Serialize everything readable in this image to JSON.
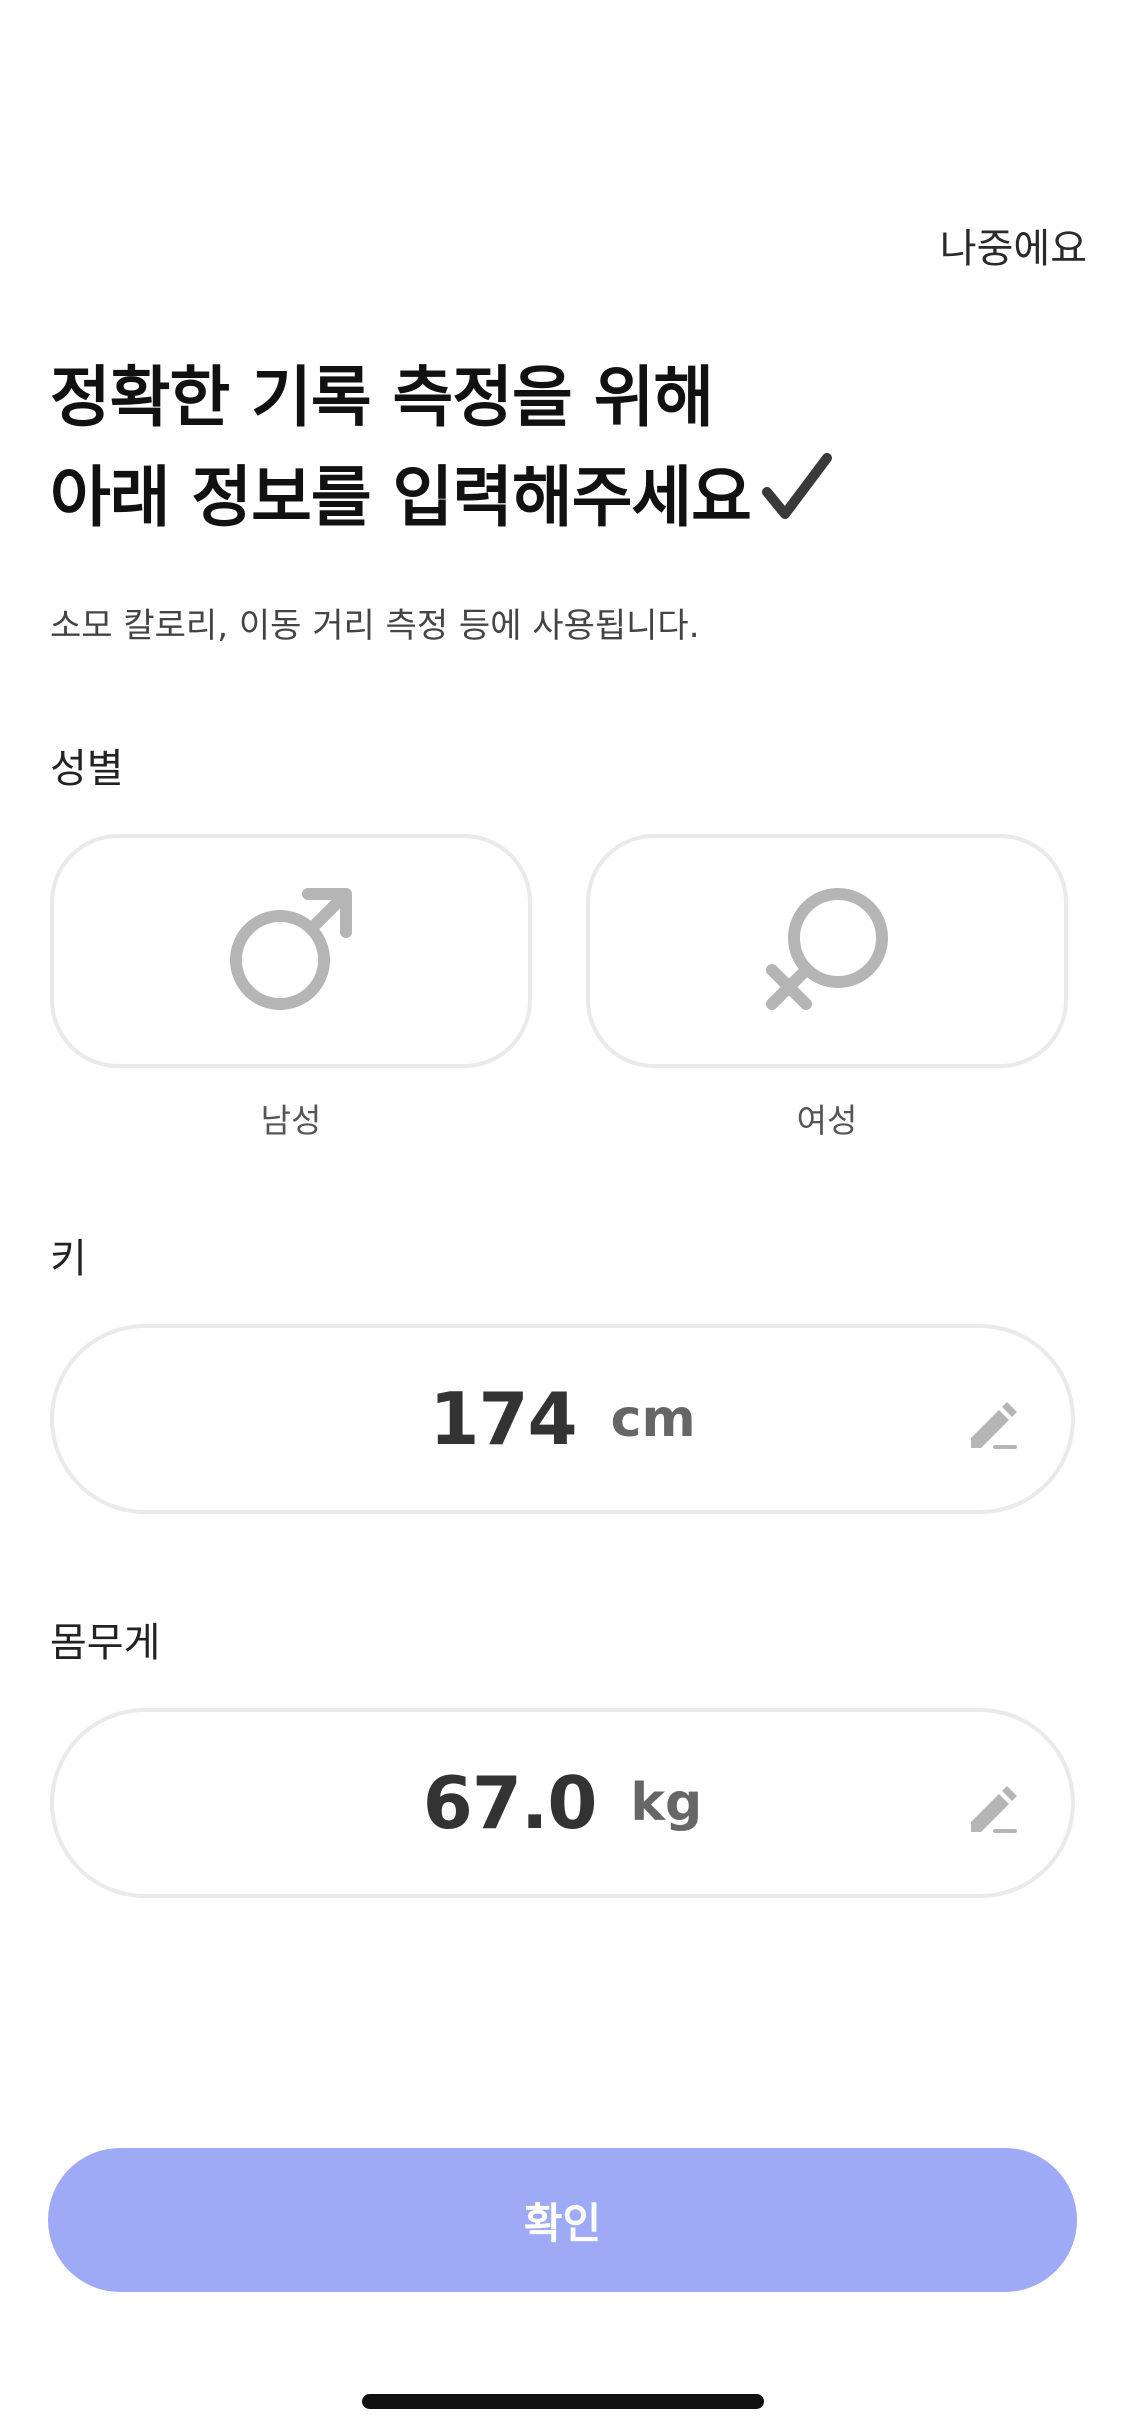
{
  "header": {
    "skip_label": "나중에요"
  },
  "intro": {
    "title_line1": "정확한 기록 측정을 위해",
    "title_line2": "아래 정보를 입력해주세요",
    "subtitle": "소모 칼로리, 이동 거리 측정 등에 사용됩니다."
  },
  "gender": {
    "label": "성별",
    "options": [
      {
        "label": "남성",
        "icon": "male-symbol-icon"
      },
      {
        "label": "여성",
        "icon": "female-symbol-icon"
      }
    ]
  },
  "height": {
    "label": "키",
    "value": "174",
    "unit": "cm"
  },
  "weight": {
    "label": "몸무게",
    "value": "67.0",
    "unit": "kg"
  },
  "footer": {
    "confirm_label": "확인"
  },
  "colors": {
    "confirm_button": "#9faaf7",
    "field_border": "#e9e9ee",
    "icon_gray": "#b5b5b5"
  }
}
